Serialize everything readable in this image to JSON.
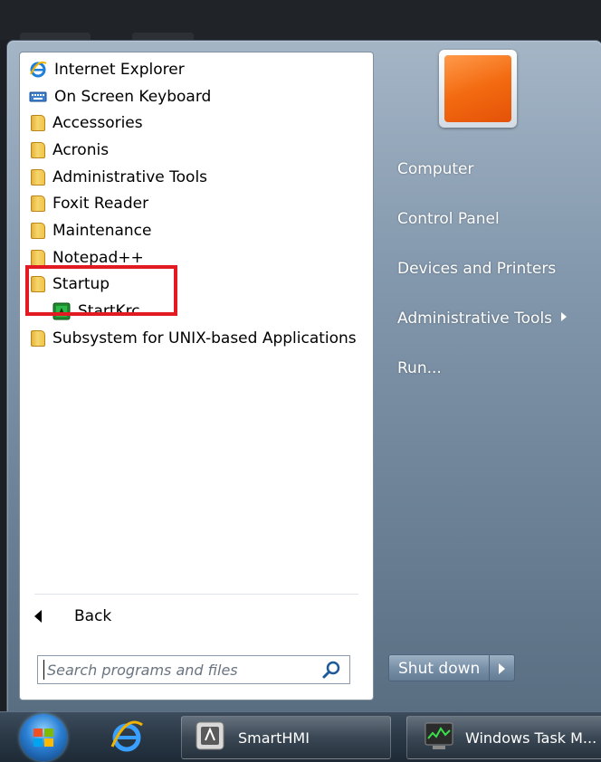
{
  "programs": [
    {
      "label": "Internet Explorer",
      "icon": "internet-explorer-icon"
    },
    {
      "label": "On Screen Keyboard",
      "icon": "keyboard-icon"
    },
    {
      "label": "Accessories",
      "icon": "folder-icon"
    },
    {
      "label": "Acronis",
      "icon": "folder-icon"
    },
    {
      "label": "Administrative Tools",
      "icon": "folder-icon"
    },
    {
      "label": "Foxit Reader",
      "icon": "folder-icon"
    },
    {
      "label": "Maintenance",
      "icon": "folder-icon"
    },
    {
      "label": "Notepad++",
      "icon": "folder-icon"
    },
    {
      "label": "Startup",
      "icon": "folder-icon"
    },
    {
      "label": "StartKrc",
      "icon": "startkrc-app-icon"
    },
    {
      "label": "Subsystem for UNIX-based Applications",
      "icon": "folder-icon"
    }
  ],
  "back_label": "Back",
  "search": {
    "placeholder": "Search programs and files"
  },
  "right_pane": {
    "items": [
      {
        "label": "Computer"
      },
      {
        "label": "Control Panel"
      },
      {
        "label": "Devices and Printers"
      },
      {
        "label": "Administrative Tools"
      },
      {
        "label": "Run..."
      }
    ],
    "shutdown_label": "Shut down"
  },
  "taskbar": {
    "buttons": [
      {
        "label": "SmartHMI"
      },
      {
        "label": "Windows Task M..."
      }
    ]
  },
  "colors": {
    "highlight": "#e21b22",
    "avatar": "#f36a10"
  }
}
